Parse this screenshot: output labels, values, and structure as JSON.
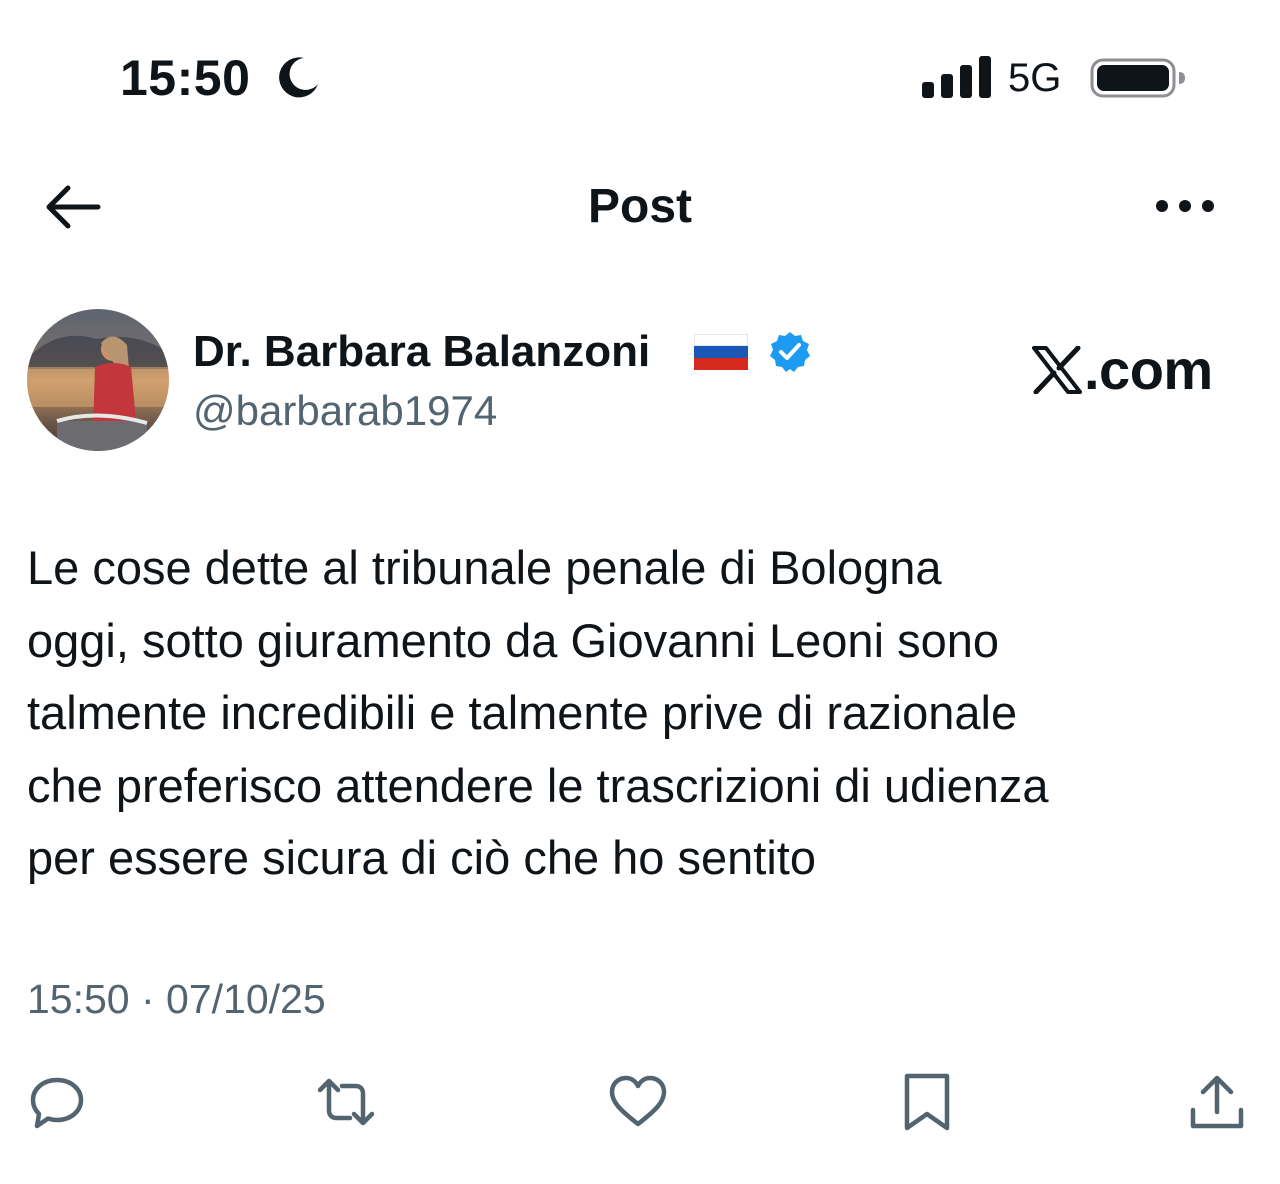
{
  "status_bar": {
    "time": "15:50",
    "network": "5G",
    "icons": [
      "moon-icon",
      "signal-icon",
      "battery-icon"
    ]
  },
  "header": {
    "title": "Post",
    "back_icon": "arrow-left-icon",
    "more_icon": "more-dots-icon"
  },
  "author": {
    "name": "Dr. Barbara Balanzoni",
    "handle": "@barbarab1974",
    "verified_color": "#1d9bf0"
  },
  "brand": {
    "text": ".com"
  },
  "post": {
    "text": "Le cose dette al tribunale penale di Bologna\noggi, sotto giuramento da Giovanni Leoni sono\ntalmente incredibili e talmente prive di razionale\nche preferisco attendere le trascrizioni di udienza\nper essere sicura di ciò che ho sentito",
    "timestamp": "15:50 · 07/10/25"
  },
  "actions": [
    "reply-icon",
    "repost-icon",
    "like-icon",
    "bookmark-icon",
    "share-icon"
  ],
  "colors": {
    "text": "#0f1419",
    "secondary": "#536471",
    "accent": "#1d9bf0"
  }
}
